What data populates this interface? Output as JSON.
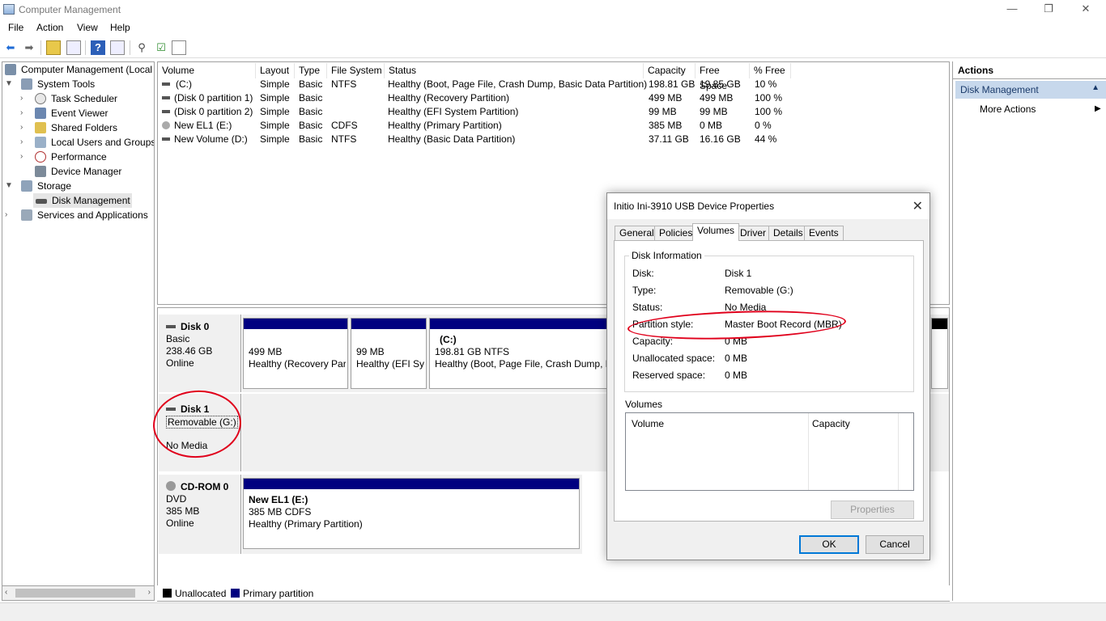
{
  "window": {
    "title": "Computer Management",
    "minimize": "—",
    "restore": "❐",
    "close": "✕"
  },
  "menu": [
    "File",
    "Action",
    "View",
    "Help"
  ],
  "tree": {
    "root": "Computer Management (Local",
    "system_tools": "System Tools",
    "items": [
      "Task Scheduler",
      "Event Viewer",
      "Shared Folders",
      "Local Users and Groups",
      "Performance",
      "Device Manager"
    ],
    "storage": "Storage",
    "disk_management": "Disk Management",
    "services": "Services and Applications"
  },
  "volumes": {
    "columns": [
      "Volume",
      "Layout",
      "Type",
      "File System",
      "Status",
      "Capacity",
      "Free Space",
      "% Free"
    ],
    "rows": [
      [
        "(C:)",
        "Simple",
        "Basic",
        "NTFS",
        "Healthy (Boot, Page File, Crash Dump, Basic Data Partition)",
        "198.81 GB",
        "19.85 GB",
        "10 %"
      ],
      [
        "(Disk 0 partition 1)",
        "Simple",
        "Basic",
        "",
        "Healthy (Recovery Partition)",
        "499 MB",
        "499 MB",
        "100 %"
      ],
      [
        "(Disk 0 partition 2)",
        "Simple",
        "Basic",
        "",
        "Healthy (EFI System Partition)",
        "99 MB",
        "99 MB",
        "100 %"
      ],
      [
        "New EL1 (E:)",
        "Simple",
        "Basic",
        "CDFS",
        "Healthy (Primary Partition)",
        "385 MB",
        "0 MB",
        "0 %"
      ],
      [
        "New Volume (D:)",
        "Simple",
        "Basic",
        "NTFS",
        "Healthy (Basic Data Partition)",
        "37.11 GB",
        "16.16 GB",
        "44 %"
      ]
    ]
  },
  "disks": {
    "disk0": {
      "name": "Disk 0",
      "type": "Basic",
      "size": "238.46 GB",
      "state": "Online",
      "p1": {
        "size": "499 MB",
        "status": "Healthy (Recovery Par"
      },
      "p2": {
        "size": "99 MB",
        "status": "Healthy (EFI Sys"
      },
      "p3": {
        "label": "(C:)",
        "size": "198.81 GB NTFS",
        "status": "Healthy (Boot, Page File, Crash Dump, Ba"
      }
    },
    "disk1": {
      "name": "Disk 1",
      "type": "Removable (G:)",
      "state": "No Media"
    },
    "cdrom": {
      "name": "CD-ROM 0",
      "type": "DVD",
      "size": "385 MB",
      "state": "Online",
      "p1": {
        "label": "New EL1  (E:)",
        "size": "385 MB CDFS",
        "status": "Healthy (Primary Partition)"
      }
    }
  },
  "legend": {
    "unallocated": "Unallocated",
    "primary": "Primary partition"
  },
  "actions": {
    "header": "Actions",
    "section": "Disk Management",
    "more": "More Actions"
  },
  "dialog": {
    "title": "Initio Ini-3910 USB Device Properties",
    "close": "✕",
    "tabs": [
      "General",
      "Policies",
      "Volumes",
      "Driver",
      "Details",
      "Events"
    ],
    "disk_info_label": "Disk Information",
    "info": [
      {
        "k": "Disk:",
        "v": "Disk 1"
      },
      {
        "k": "Type:",
        "v": "Removable (G:)"
      },
      {
        "k": "Status:",
        "v": "No Media"
      },
      {
        "k": "Partition style:",
        "v": "Master Boot Record (MBR)"
      },
      {
        "k": "Capacity:",
        "v": "0 MB"
      },
      {
        "k": "Unallocated space:",
        "v": "0 MB"
      },
      {
        "k": "Reserved space:",
        "v": "0 MB"
      }
    ],
    "volumes_label": "Volumes",
    "vol_col1": "Volume",
    "vol_col2": "Capacity",
    "properties_btn": "Properties",
    "ok": "OK",
    "cancel": "Cancel"
  },
  "colors": {
    "primary": "#000080",
    "accent": "#0078d7",
    "annotation": "#e0001b"
  }
}
